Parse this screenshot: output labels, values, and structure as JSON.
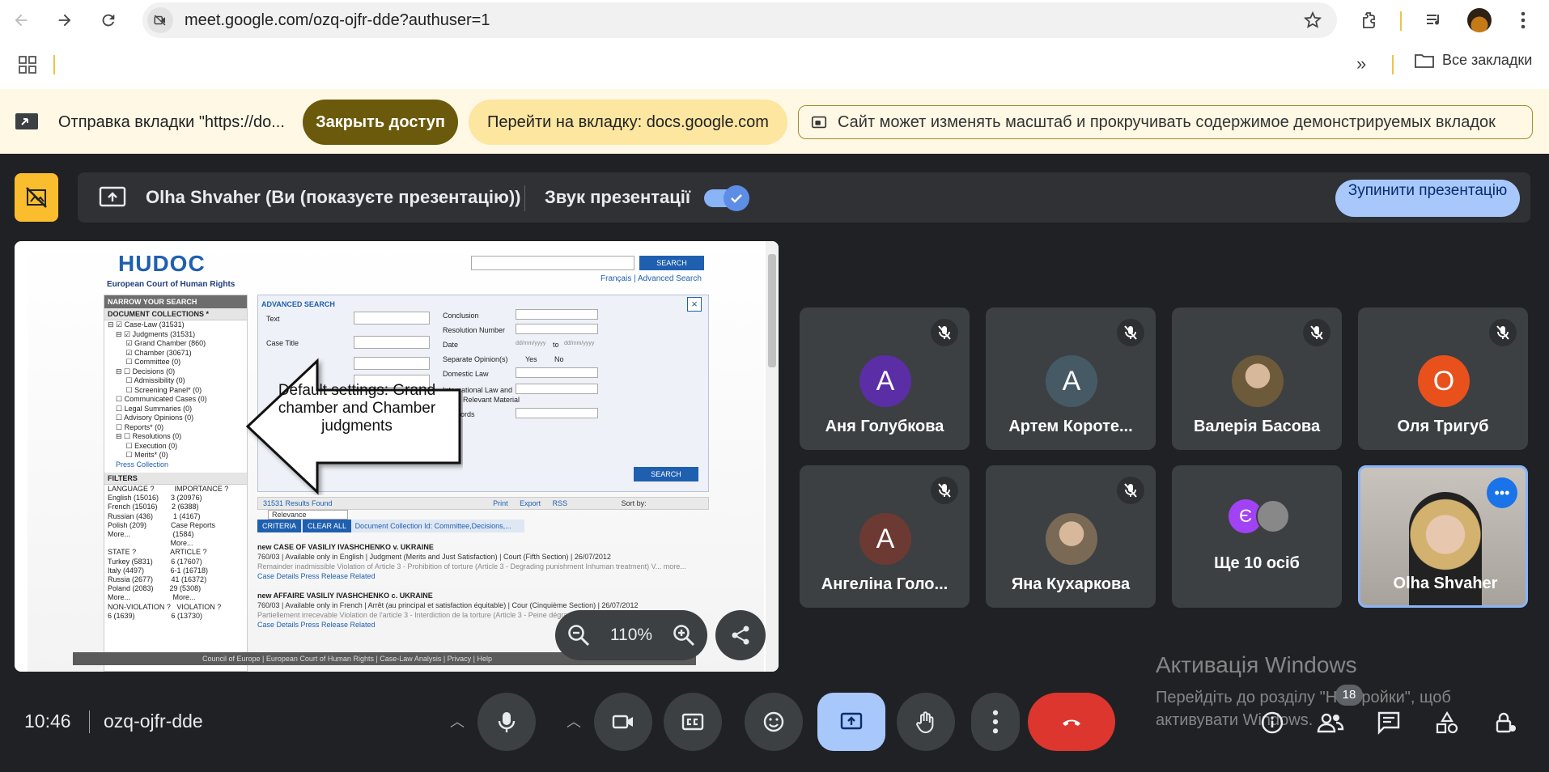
{
  "browser": {
    "url": "meet.google.com/ozq-ojfr-dde?authuser=1",
    "bookmarks_all": "Все закладки"
  },
  "share_bar": {
    "text": "Отправка вкладки \"https://do...",
    "close_access": "Закрыть доступ",
    "go_to_tab": "Перейти на вкладку: docs.google.com",
    "zoom_message": "Сайт может изменять масштаб и прокручивать содержимое демонстрируемых вкладок"
  },
  "presenting": {
    "name": "Olha Shvaher (Ви (показуєте презентацію))",
    "sound_label": "Звук презентації",
    "sound_on": true,
    "stop_button": "Зупинити презентацію"
  },
  "shared_screen": {
    "logo": "HUDOC",
    "logo_sub": "European Court of Human Rights",
    "search_btn": "SEARCH",
    "links": "Français  |  Advanced Search",
    "narrow_title": "NARROW YOUR SEARCH",
    "doc_collections": "DOCUMENT COLLECTIONS *",
    "tree": [
      "⊟ ☑ Case-Law (31531)",
      "    ⊟ ☑ Judgments (31531)",
      "         ☑ Grand Chamber (860)",
      "         ☑ Chamber (30671)",
      "         ☐ Committee (0)",
      "    ⊟ ☐ Decisions (0)",
      "         ☐ Admissibility (0)",
      "         ☐ Screening Panel* (0)",
      "    ☐ Communicated Cases (0)",
      "    ☐ Legal Summaries (0)",
      "    ☐ Advisory Opinions (0)",
      "    ☐ Reports* (0)",
      "    ⊟ ☐ Resolutions (0)",
      "         ☐ Execution (0)",
      "         ☐ Merits* (0)",
      "    Press Collection"
    ],
    "filters_title": "FILTERS",
    "filters": [
      "LANGUAGE ?          IMPORTANCE ?",
      "English (15016)      3 (20976)",
      "French (15016)       2 (6388)",
      "Russian (436)          1 (4167)",
      "Polish (209)            Case Reports",
      "More...                     (1584)",
      "                               More...",
      "STATE ?                 ARTICLE ?",
      "Turkey (5831)         6 (17607)",
      "Italy (4497)             6-1 (16718)",
      "Russia (2677)         41 (16372)",
      "Poland (2083)        29 (5308)",
      "More...                     More...",
      "NON-VIOLATION ?   VIOLATION ?",
      "6 (1639)                  6 (13730)"
    ],
    "adv_title": "ADVANCED SEARCH",
    "adv_fields_left": [
      "Text",
      "Case Title"
    ],
    "adv_fields_right": [
      "Conclusion",
      "Resolution Number",
      "Date",
      "Separate Opinion(s)",
      "Domestic Law",
      "International Law and",
      "Other Relevant Material",
      "Keywords"
    ],
    "date_placeholder": "dd/mm/yyyy",
    "date_to": "to",
    "yes": "Yes",
    "no": "No",
    "results": "31531 Results Found",
    "print": "Print",
    "export": "Export",
    "rss": "RSS",
    "sort_label": "Sort by:",
    "sort_value": "Relevance",
    "criteria": "CRITERIA",
    "clear_all": "CLEAR ALL",
    "criteria_text": "Document Collection Id: Committee,Decisions,...",
    "cases": [
      {
        "title": "new  CASE OF VASILIY IVASHCHENKO v. UKRAINE",
        "meta": "760/03  |  Available only in English  |  Judgment (Merits and Just Satisfaction)  |  Court (Fifth Section)  |  26/07/2012",
        "summary": "Remainder inadmissible Violation of Article 3 - Prohibition of torture (Article 3 - Degrading punishment Inhuman treatment) V... more...",
        "links": "Case Details   Press Release   Related"
      },
      {
        "title": "new  AFFAIRE VASILIY IVASHCHENKO c. UKRAINE",
        "meta": "760/03  |  Available only in French  |  Arrêt (au principal et satisfaction équitable)  |  Cour (Cinquième Section)  |  26/07/2012",
        "summary": "Partiellement irrecevable Violation de l'article 3 - Interdiction de la torture (Article 3 - Peine dégradante...",
        "links": "Case Details   Press Release   Related"
      }
    ],
    "footer": "Council of Europe  |  European Court of Human Rights  |  Case-Law Analysis  |  Privacy  |  Help",
    "callout": "Default settings: Grand chamber and Chamber judgments",
    "zoom_level": "110%"
  },
  "participants": [
    {
      "name": "Аня Голубкова",
      "initial": "А",
      "color": "#5b2ea6",
      "muted": true
    },
    {
      "name": "Артем Коротe...",
      "initial": "А",
      "color": "#455a64",
      "muted": true
    },
    {
      "name": "Валерія Басова",
      "initial": "",
      "color": "#6d5a3a",
      "muted": true
    },
    {
      "name": "Оля Тригуб",
      "initial": "О",
      "color": "#e8501c",
      "muted": true
    },
    {
      "name": "Ангеліна Голо...",
      "initial": "А",
      "color": "#6d3a33",
      "muted": true
    },
    {
      "name": "Яна Кухаркова",
      "initial": "",
      "color": "#7a6a55",
      "muted": true
    },
    {
      "name": "Ще 10 осіб",
      "initial": "Є",
      "color": "#a142f4",
      "muted": false
    },
    {
      "name": "Olha Shvaher",
      "initial": "",
      "color": "#b0a89e",
      "muted": false
    }
  ],
  "meeting": {
    "time": "10:46",
    "code": "ozq-ojfr-dde",
    "participants_count": "18"
  },
  "windows_watermark": {
    "title": "Активація Windows",
    "text": "Перейдіть до розділу \"Настройки\", щоб активувати Windows."
  }
}
